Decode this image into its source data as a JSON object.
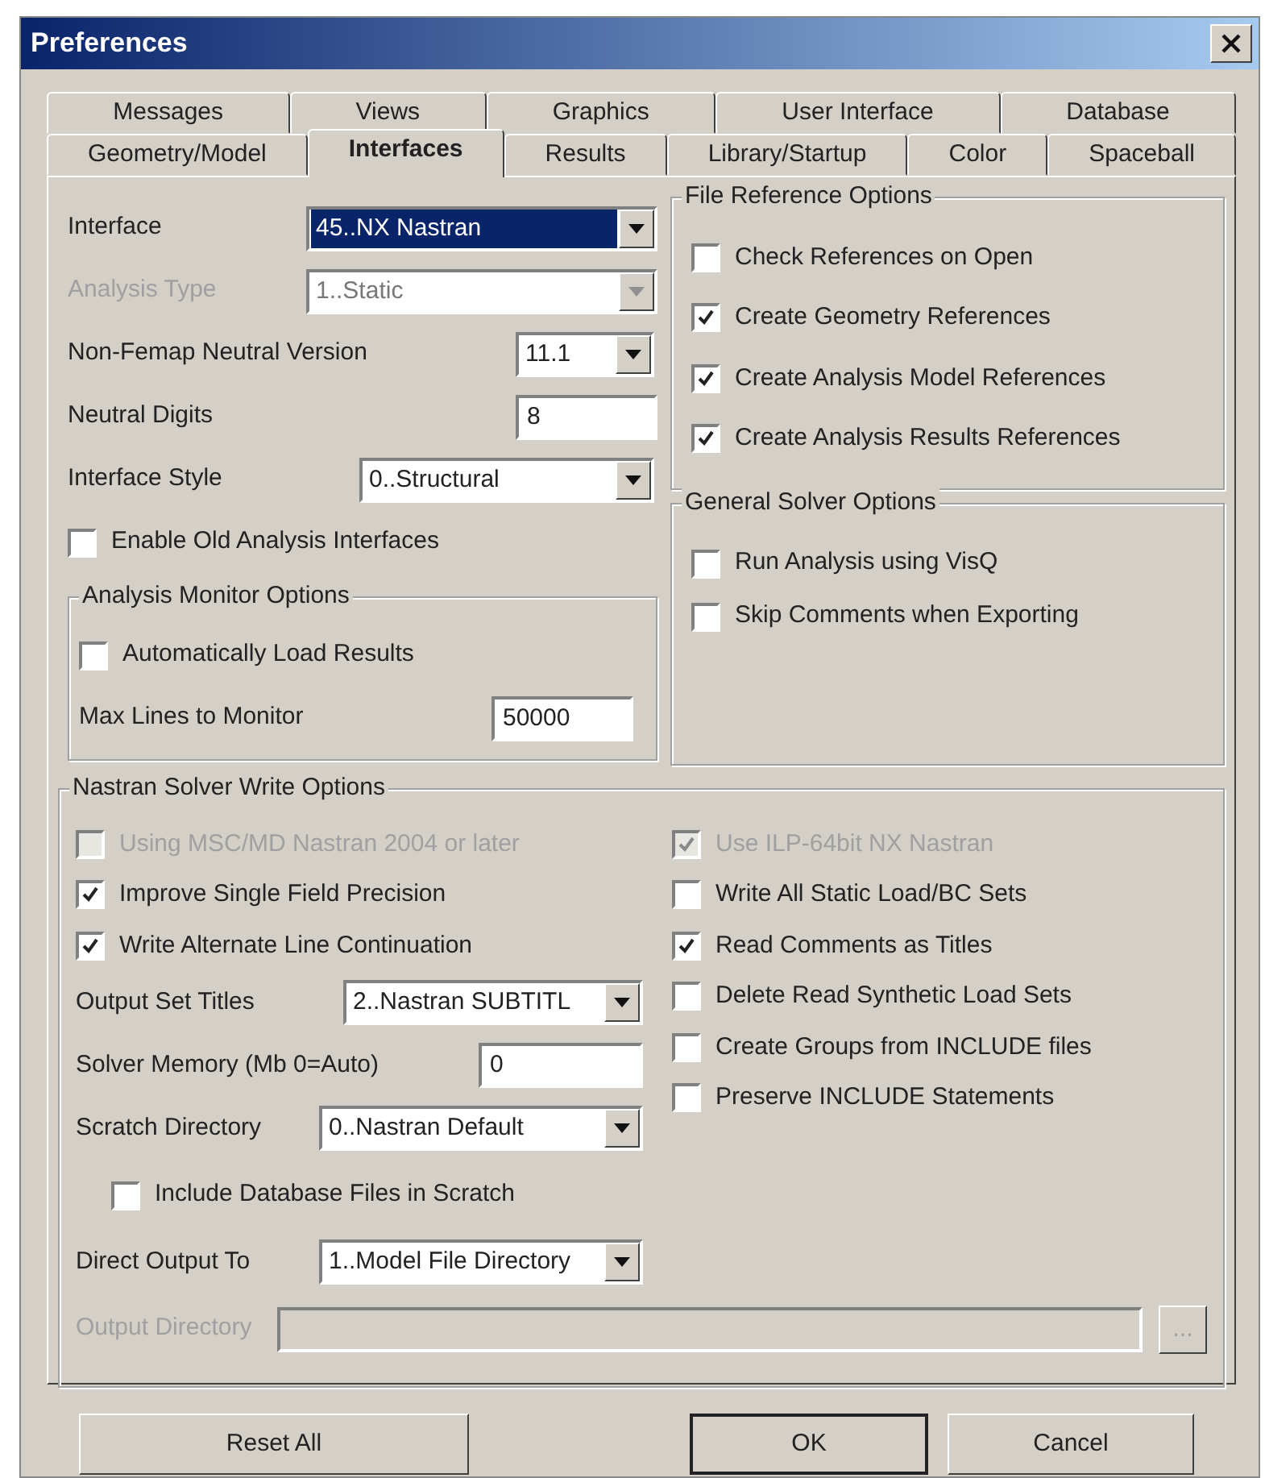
{
  "window": {
    "title": "Preferences"
  },
  "tab_rows": [
    [
      {
        "label": "Messages",
        "selected": false
      },
      {
        "label": "Views",
        "selected": false
      },
      {
        "label": "Graphics",
        "selected": false
      },
      {
        "label": "User Interface",
        "selected": false
      },
      {
        "label": "Database",
        "selected": false
      }
    ],
    [
      {
        "label": "Geometry/Model",
        "selected": false
      },
      {
        "label": "Interfaces",
        "selected": true
      },
      {
        "label": "Results",
        "selected": false
      },
      {
        "label": "Library/Startup",
        "selected": false
      },
      {
        "label": "Color",
        "selected": false
      },
      {
        "label": "Spaceball",
        "selected": false
      }
    ]
  ],
  "interface_settings": [
    {
      "kind": "select",
      "label": "Interface",
      "value": "45..NX Nastran",
      "disabled": false,
      "highlighted": true
    },
    {
      "kind": "select",
      "label": "Analysis Type",
      "value": "1..Static",
      "disabled": true,
      "highlighted": false
    },
    {
      "kind": "select",
      "label": "Non-Femap Neutral Version",
      "value": "11.1",
      "disabled": false,
      "highlighted": false
    },
    {
      "kind": "input",
      "label": "Neutral Digits",
      "value": "8",
      "disabled": false
    },
    {
      "kind": "select",
      "label": "Interface Style",
      "value": "0..Structural",
      "disabled": false,
      "highlighted": false
    },
    {
      "kind": "checkbox",
      "label": "Enable Old Analysis Interfaces",
      "checked": false,
      "disabled": false
    }
  ],
  "analysis_monitor_options": {
    "title": "Analysis Monitor Options",
    "items": [
      {
        "kind": "checkbox",
        "label": "Automatically Load Results",
        "checked": false,
        "disabled": false
      },
      {
        "kind": "input",
        "label": "Max Lines to Monitor",
        "value": "50000",
        "disabled": false
      }
    ]
  },
  "file_reference_options": {
    "title": "File Reference Options",
    "items": [
      {
        "kind": "checkbox",
        "label": "Check References on Open",
        "checked": false,
        "disabled": false
      },
      {
        "kind": "checkbox",
        "label": "Create Geometry References",
        "checked": true,
        "disabled": false
      },
      {
        "kind": "checkbox",
        "label": "Create Analysis Model References",
        "checked": true,
        "disabled": false
      },
      {
        "kind": "checkbox",
        "label": "Create Analysis Results References",
        "checked": true,
        "disabled": false
      }
    ]
  },
  "general_solver_options": {
    "title": "General Solver Options",
    "items": [
      {
        "kind": "checkbox",
        "label": "Run Analysis using VisQ",
        "checked": false,
        "disabled": false
      },
      {
        "kind": "checkbox",
        "label": "Skip Comments when Exporting",
        "checked": false,
        "disabled": false
      }
    ]
  },
  "nastran_solver_write_options": {
    "title": "Nastran Solver Write Options",
    "left": [
      {
        "kind": "checkbox",
        "label": "Using MSC/MD Nastran 2004 or later",
        "checked": false,
        "disabled": true
      },
      {
        "kind": "checkbox",
        "label": "Improve Single Field Precision",
        "checked": true,
        "disabled": false
      },
      {
        "kind": "checkbox",
        "label": "Write Alternate Line Continuation",
        "checked": true,
        "disabled": false
      },
      {
        "kind": "select",
        "label": "Output Set Titles",
        "value": "2..Nastran SUBTITL",
        "disabled": false,
        "highlighted": false
      },
      {
        "kind": "input",
        "label": "Solver Memory (Mb 0=Auto)",
        "value": "0",
        "disabled": false
      },
      {
        "kind": "select",
        "label": "Scratch Directory",
        "value": "0..Nastran Default",
        "disabled": false,
        "highlighted": false
      },
      {
        "kind": "subcheckbox",
        "label": "Include Database Files in Scratch",
        "checked": false,
        "disabled": false
      },
      {
        "kind": "select",
        "label": "Direct Output To",
        "value": "1..Model File Directory",
        "disabled": false,
        "highlighted": false
      }
    ],
    "right": [
      {
        "kind": "checkbox",
        "label": "Use ILP-64bit NX Nastran",
        "checked": true,
        "disabled": true
      },
      {
        "kind": "checkbox",
        "label": "Write All Static Load/BC Sets",
        "checked": false,
        "disabled": false
      },
      {
        "kind": "checkbox",
        "label": "Read Comments as Titles",
        "checked": true,
        "disabled": false
      },
      {
        "kind": "checkbox",
        "label": "Delete Read Synthetic Load Sets",
        "checked": false,
        "disabled": false
      },
      {
        "kind": "checkbox",
        "label": "Create Groups from INCLUDE files",
        "checked": false,
        "disabled": false
      },
      {
        "kind": "checkbox",
        "label": "Preserve INCLUDE Statements",
        "checked": false,
        "disabled": false
      }
    ],
    "output_directory": {
      "label": "Output Directory",
      "disabled": true,
      "browse": "..."
    }
  },
  "buttons": [
    {
      "label": "Reset All",
      "default": false
    },
    {
      "label": "OK",
      "default": true
    },
    {
      "label": "Cancel",
      "default": false
    }
  ]
}
